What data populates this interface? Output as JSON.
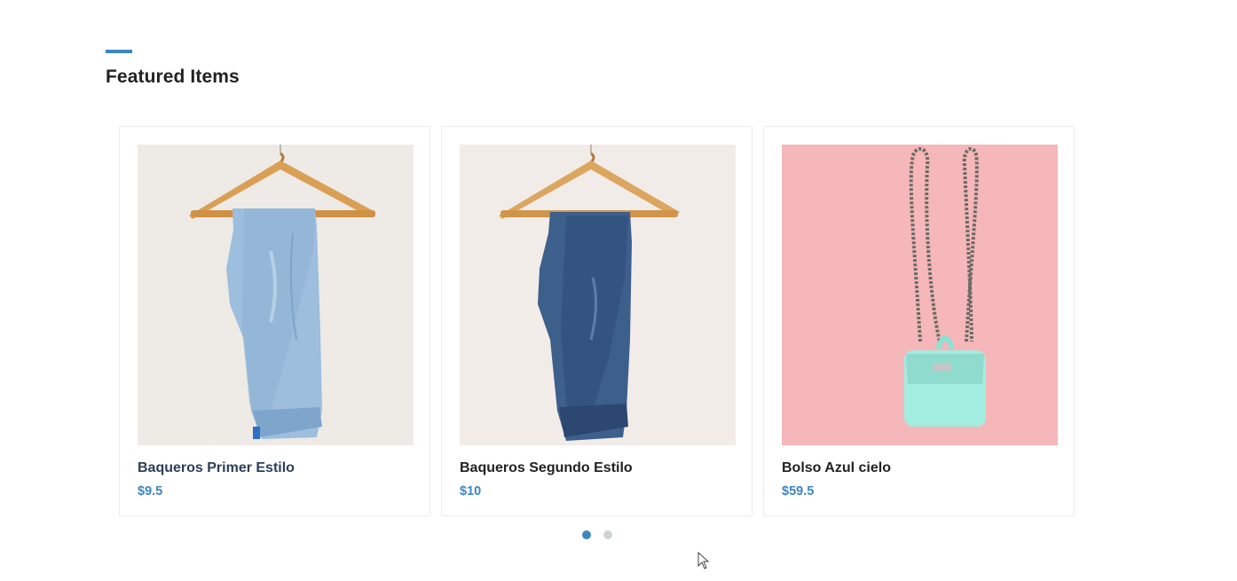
{
  "section": {
    "title": "Featured Items",
    "accent_color": "#3d86c1"
  },
  "products": [
    {
      "name": "Baqueros Primer Estilo",
      "price": "$9.5",
      "image": "light-wash-jeans-on-hanger"
    },
    {
      "name": "Baqueros Segundo Estilo",
      "price": "$10",
      "image": "dark-wash-jeans-on-hanger"
    },
    {
      "name": "Bolso Azul cielo",
      "price": "$59.5",
      "image": "mint-chain-handbag-on-pink"
    }
  ],
  "carousel": {
    "pages": 2,
    "active_page": 1
  }
}
